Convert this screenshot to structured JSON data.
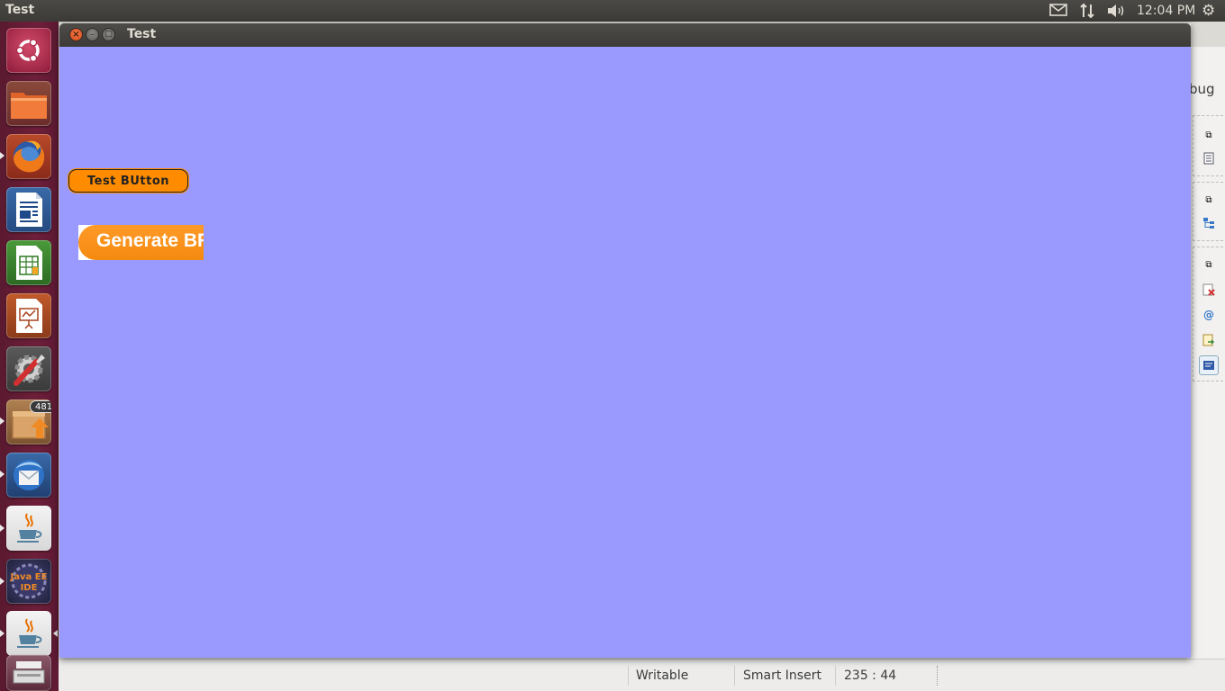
{
  "top_panel": {
    "app_title": "Test",
    "clock": "12:04 PM",
    "indicators": [
      "mail-icon",
      "network-icon",
      "volume-icon",
      "settings-gear-icon"
    ]
  },
  "launcher": {
    "items": [
      {
        "name": "ubuntu-dash",
        "icon": "ubuntu-logo-icon"
      },
      {
        "name": "files",
        "icon": "folder-icon"
      },
      {
        "name": "firefox",
        "icon": "firefox-icon"
      },
      {
        "name": "libreoffice-writer",
        "icon": "writer-icon"
      },
      {
        "name": "libreoffice-calc",
        "icon": "calc-icon"
      },
      {
        "name": "libreoffice-impress",
        "icon": "impress-icon"
      },
      {
        "name": "system-settings",
        "icon": "settings-tools-icon"
      },
      {
        "name": "software-updater",
        "icon": "update-box-icon",
        "badge": "481"
      },
      {
        "name": "thunderbird",
        "icon": "thunderbird-icon"
      },
      {
        "name": "java",
        "icon": "java-cup-icon"
      },
      {
        "name": "eclipse-java-ee",
        "icon": "java-ee-ide-icon",
        "label": "Java EE IDE"
      },
      {
        "name": "java-running",
        "icon": "java-cup-icon"
      },
      {
        "name": "scanner",
        "icon": "scanner-icon"
      }
    ]
  },
  "test_window": {
    "title": "Test",
    "background_color": "#9999fe",
    "test_button_label": "Test BUtton",
    "generate_button_label": "Generate BR",
    "accent_color": "#ff8c00"
  },
  "background_editor": {
    "debug_label": "bug",
    "status": {
      "mode": "Writable",
      "insert": "Smart Insert",
      "position": "235 : 44"
    }
  }
}
